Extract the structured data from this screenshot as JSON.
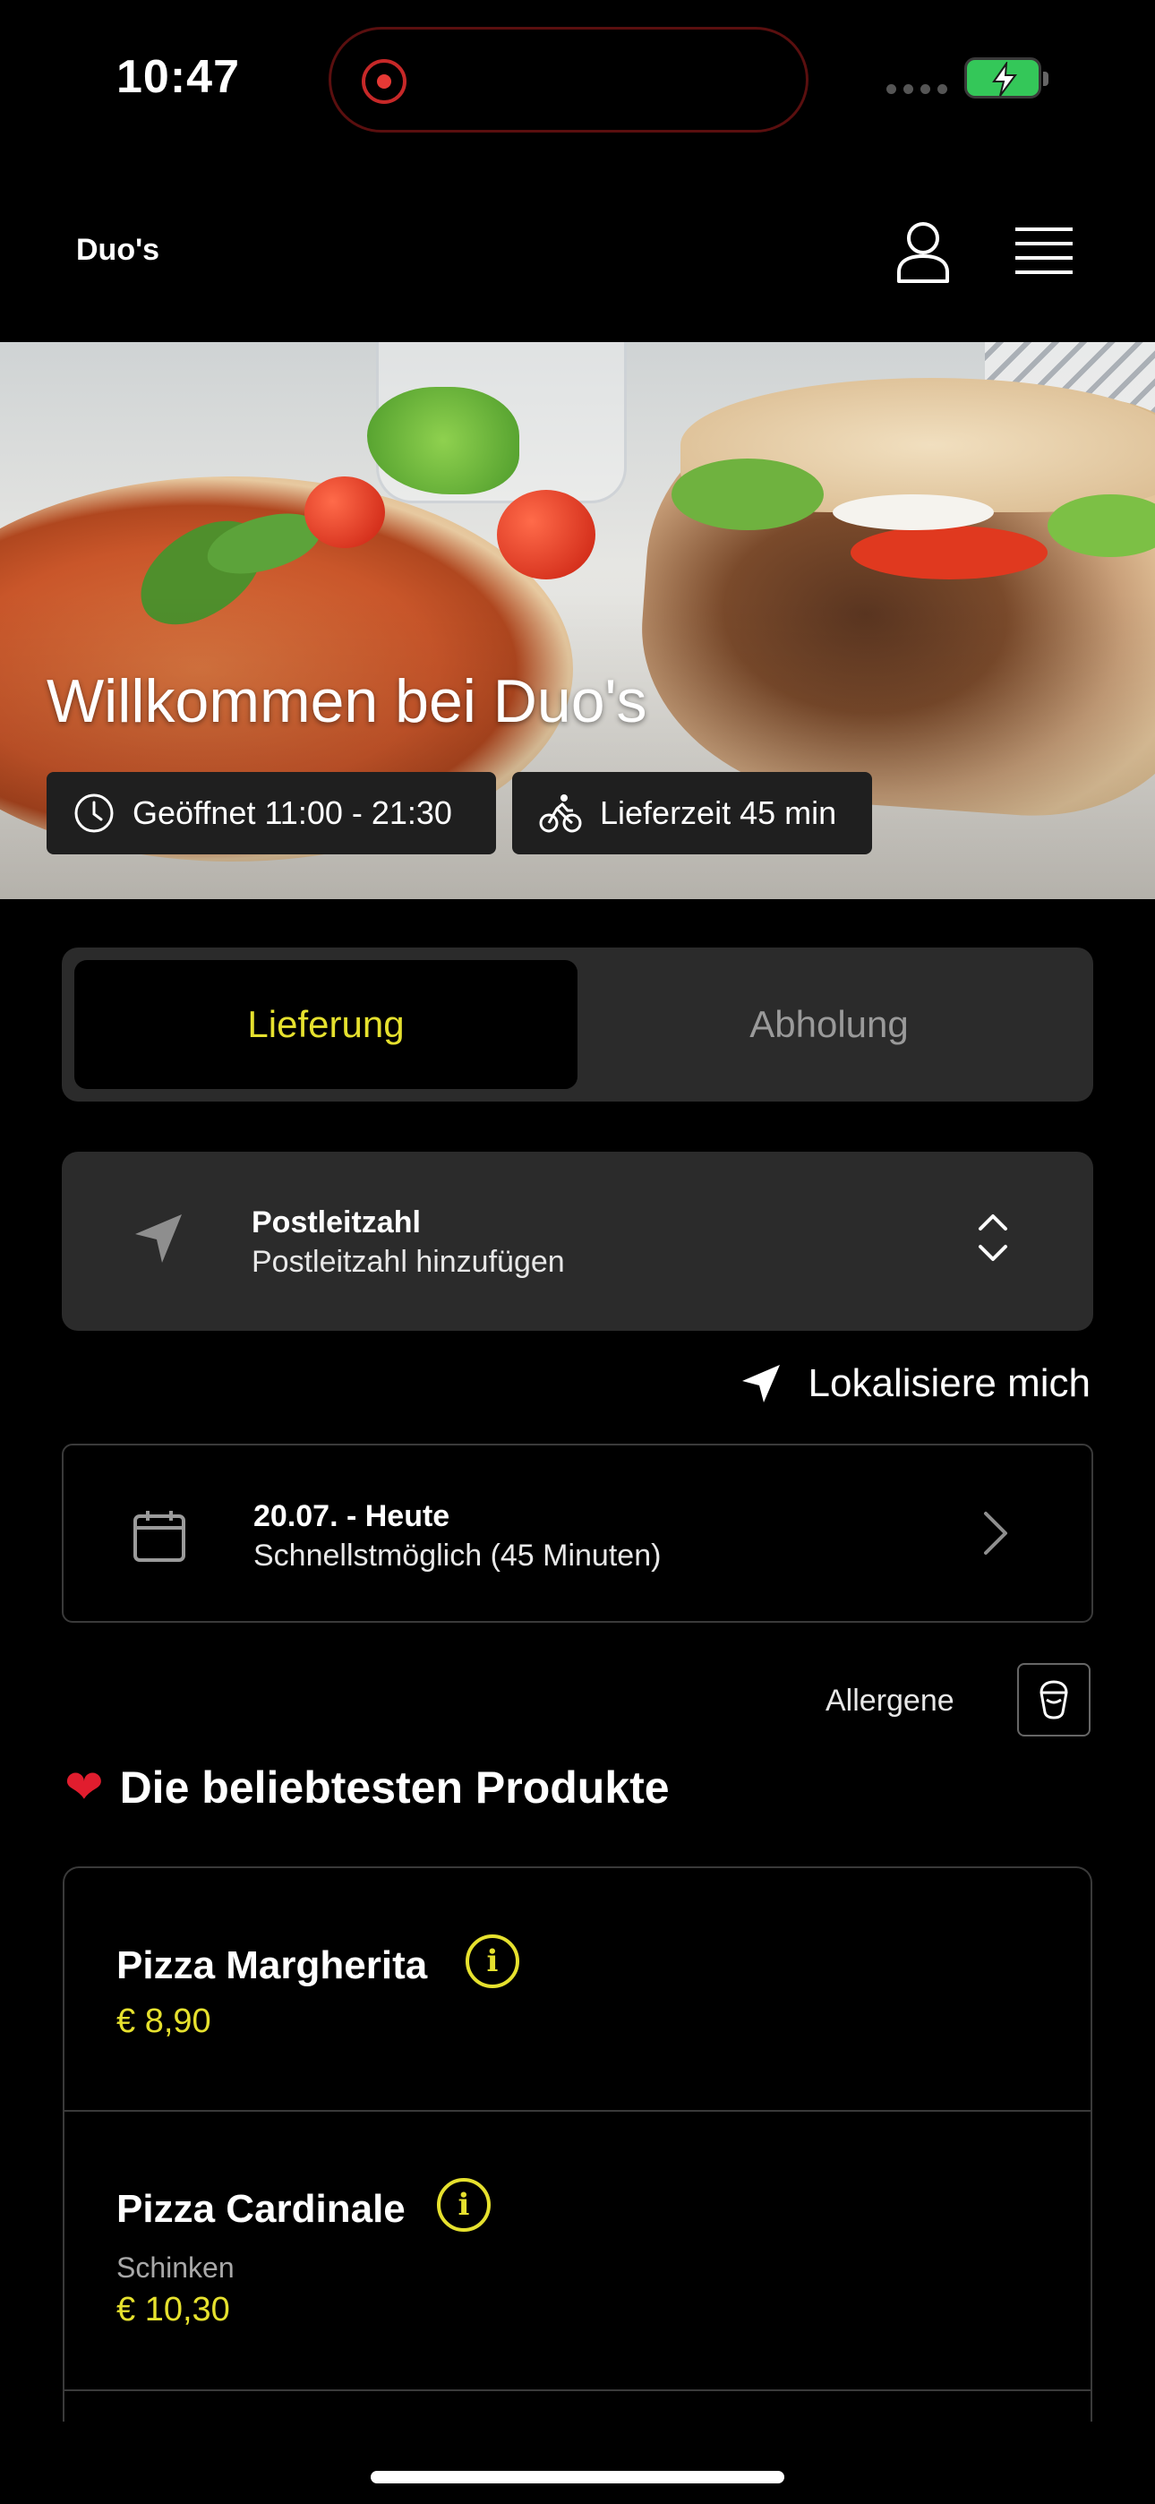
{
  "status_bar": {
    "time": "10:47"
  },
  "header": {
    "brand": "Duo's"
  },
  "hero": {
    "title": "Willkommen bei Duo's",
    "open_hours": "Geöffnet 11:00 - 21:30",
    "delivery_time": "Lieferzeit 45 min"
  },
  "order_mode": {
    "tabs": [
      {
        "label": "Lieferung",
        "active": true
      },
      {
        "label": "Abholung",
        "active": false
      }
    ]
  },
  "zip": {
    "title": "Postleitzahl",
    "placeholder": "Postleitzahl hinzufügen"
  },
  "locate": {
    "label": "Lokalisiere mich"
  },
  "date": {
    "title": "20.07. - Heute",
    "subtitle": "Schnellstmöglich (45 Minuten)"
  },
  "allergens": {
    "label": "Allergene"
  },
  "popular": {
    "title": "Die beliebtesten Produkte",
    "products": [
      {
        "name": "Pizza Margherita",
        "description": "",
        "price": "€ 8,90"
      },
      {
        "name": "Pizza Cardinale",
        "description": "Schinken",
        "price": "€ 10,30"
      }
    ]
  },
  "colors": {
    "accent": "#e6e12e",
    "background": "#000000",
    "surface": "#2b2b2b",
    "battery": "#34c759"
  },
  "icons": [
    "record-icon",
    "signal-icon",
    "battery-icon",
    "user-icon",
    "menu-icon",
    "clock-icon",
    "bicycle-icon",
    "navigation-arrow-icon",
    "chevron-up-down-icon",
    "calendar-icon",
    "chevron-right-icon",
    "allergen-icon",
    "heart-icon",
    "info-icon"
  ]
}
